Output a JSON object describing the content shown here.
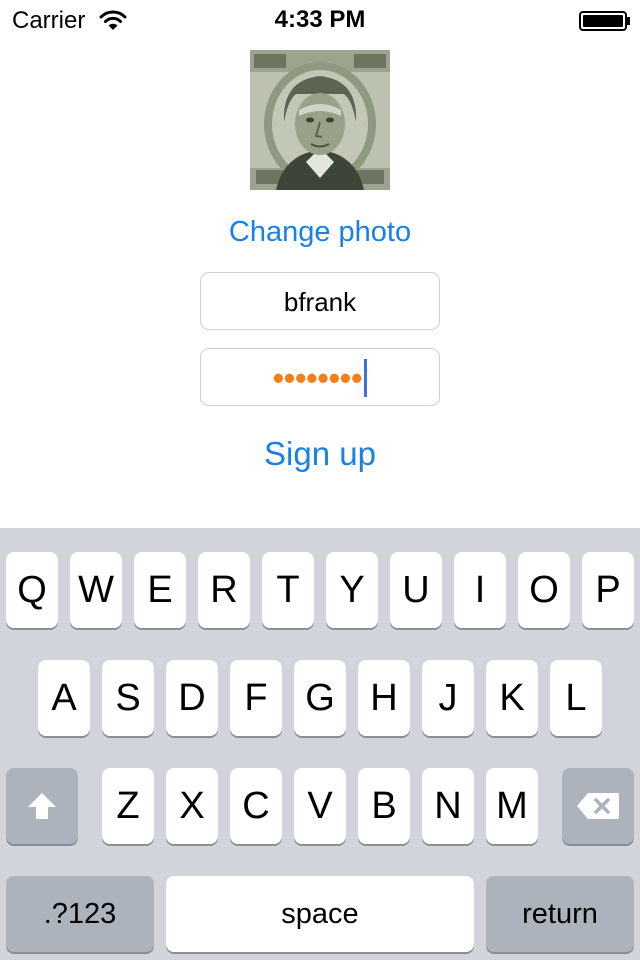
{
  "status_bar": {
    "carrier": "Carrier",
    "time": "4:33 PM",
    "wifi_icon": "wifi-icon",
    "battery_icon": "battery-icon"
  },
  "profile": {
    "photo": "hundred-dollar-bill-portrait",
    "change_photo_label": "Change photo",
    "username_value": "bfrank",
    "password_masked": "••••••••",
    "password_length": 8,
    "sign_up_label": "Sign up",
    "accent_color": "#1a7fe6",
    "password_dot_color": "#f57f17"
  },
  "keyboard": {
    "row1": [
      "Q",
      "W",
      "E",
      "R",
      "T",
      "Y",
      "U",
      "I",
      "O",
      "P"
    ],
    "row2": [
      "A",
      "S",
      "D",
      "F",
      "G",
      "H",
      "J",
      "K",
      "L"
    ],
    "row3": [
      "Z",
      "X",
      "C",
      "V",
      "B",
      "N",
      "M"
    ],
    "shift_icon": "shift-icon",
    "delete_icon": "delete-icon",
    "numbers_label": ".?123",
    "space_label": "space",
    "return_label": "return"
  }
}
